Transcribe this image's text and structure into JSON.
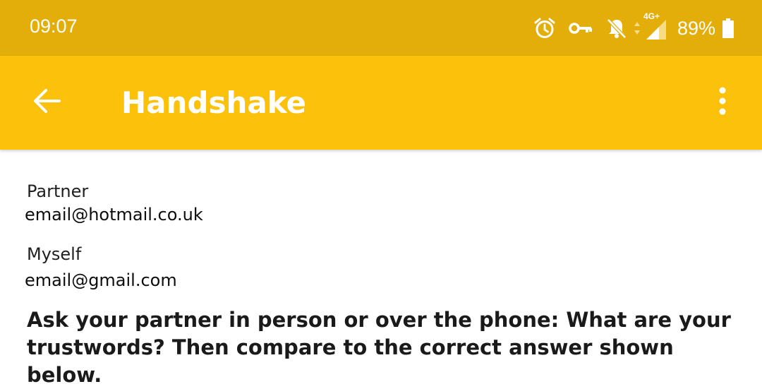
{
  "status_bar": {
    "time": "09:07",
    "icons": [
      "alarm-icon",
      "vpn-key-icon",
      "notifications-off-icon",
      "data-arrows-icon",
      "signal-4g-icon"
    ],
    "network_type": "4G+",
    "battery_percent": "89%",
    "battery_level": 0.89,
    "color": "#e3ae0a"
  },
  "app_bar": {
    "title": "Handshake",
    "back_icon": "arrow-back-icon",
    "menu_icon": "more-vert-icon",
    "color": "#fcc10b"
  },
  "partner": {
    "label": "Partner",
    "email": "email@hotmail.co.uk"
  },
  "myself": {
    "label": "Myself",
    "email": "email@gmail.com"
  },
  "instructions": "Ask your partner in person or over the phone: What are your trustwords? Then compare to the correct answer shown below."
}
